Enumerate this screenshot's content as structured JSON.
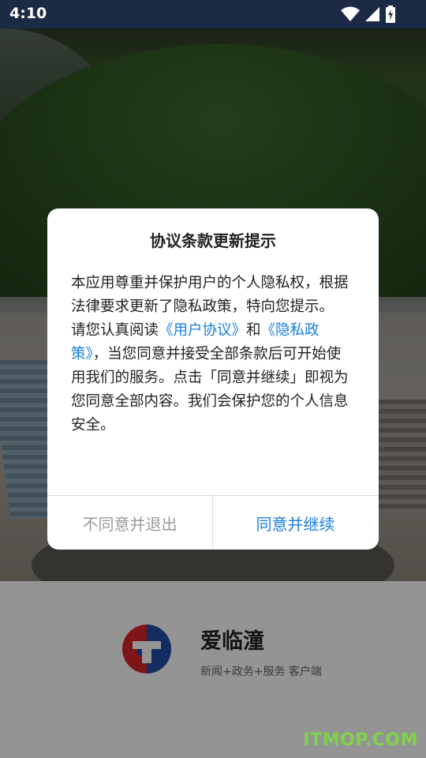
{
  "status_bar": {
    "time": "4:10",
    "icons": [
      "wifi-icon",
      "signal-icon",
      "battery-charging-icon"
    ]
  },
  "dialog": {
    "title": "协议条款更新提示",
    "paragraph1": "本应用尊重并保护用户的个人隐私权，根据法律要求更新了隐私政策，特向您提示。",
    "paragraph2_prefix": "请您认真阅读",
    "user_agreement_link": "《用户协议》",
    "and_text": "和",
    "privacy_policy_link": "《隐私政策》",
    "paragraph2_suffix": "，当您同意并接受全部条款后可开始使用我们的服务。点击「同意并继续」即视为您同意全部内容。我们会保护您的个人信息安全。",
    "disagree_button": "不同意并退出",
    "agree_button": "同意并继续"
  },
  "app": {
    "name": "爱临潼",
    "subtitle": "新闻+政务+服务 客户端"
  },
  "watermark": "ITMOP.COM",
  "colors": {
    "status_bar_bg": "#1c2a45",
    "link": "#1a7fe0",
    "agree_button": "#1a7fe0",
    "disagree_button": "#9a9a9a",
    "watermark": "#7fd34a"
  }
}
